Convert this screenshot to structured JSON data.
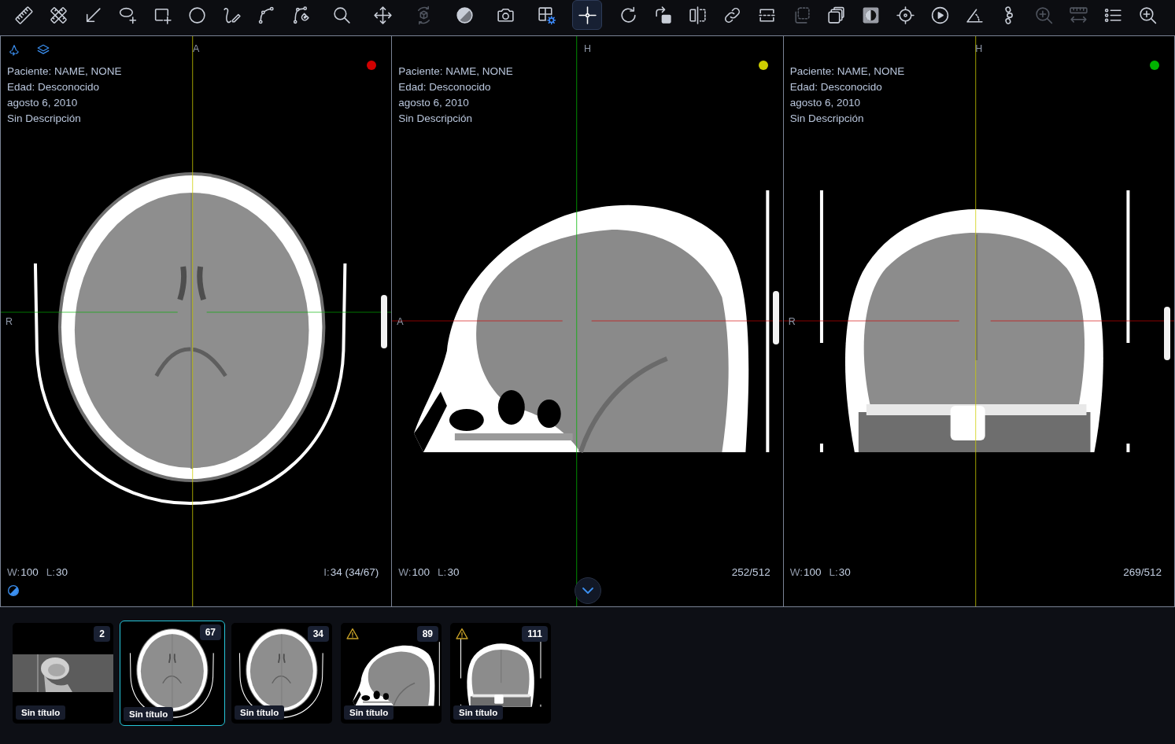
{
  "toolbar": {
    "items": [
      {
        "selected": false,
        "disabled": false
      },
      {
        "selected": false,
        "disabled": false
      },
      {
        "selected": false,
        "disabled": false
      },
      {
        "selected": false,
        "disabled": false
      },
      {
        "selected": false,
        "disabled": false
      },
      {
        "selected": false,
        "disabled": false
      },
      {
        "selected": false,
        "disabled": false
      },
      {
        "selected": false,
        "disabled": false
      },
      {
        "selected": false,
        "disabled": false
      },
      {
        "selected": false,
        "disabled": false
      },
      {
        "selected": false,
        "disabled": false
      },
      {
        "selected": false,
        "disabled": true
      },
      {
        "selected": false,
        "disabled": false
      },
      {
        "selected": false,
        "disabled": false
      },
      {
        "selected": false,
        "disabled": false
      },
      {
        "selected": true,
        "disabled": false
      },
      {
        "selected": false,
        "disabled": false
      },
      {
        "selected": false,
        "disabled": false
      },
      {
        "selected": false,
        "disabled": false
      },
      {
        "selected": false,
        "disabled": false
      },
      {
        "selected": false,
        "disabled": false
      },
      {
        "selected": false,
        "disabled": true
      },
      {
        "selected": false,
        "disabled": false
      },
      {
        "selected": false,
        "disabled": false
      },
      {
        "selected": false,
        "disabled": false
      },
      {
        "selected": false,
        "disabled": false
      },
      {
        "selected": false,
        "disabled": false
      },
      {
        "selected": false,
        "disabled": false
      },
      {
        "selected": false,
        "disabled": true
      },
      {
        "selected": false,
        "disabled": true
      },
      {
        "selected": false,
        "disabled": false
      },
      {
        "selected": false,
        "disabled": false
      }
    ]
  },
  "viewports": [
    {
      "kind": "axial",
      "selected": true,
      "color": "#d00000",
      "orientation_top": "A",
      "orientation_left": "R",
      "patient": "Paciente: NAME, NONE",
      "age": "Edad: Desconocido",
      "date": "agosto 6, 2010",
      "description": "Sin Descripción",
      "window_width": {
        "label": "W:",
        "value": "100"
      },
      "window_level": {
        "label": "L:",
        "value": "30"
      },
      "slice": {
        "label": "I:",
        "value": "34 (34/67)"
      }
    },
    {
      "kind": "sagittal",
      "selected": false,
      "color": "#cccc00",
      "orientation_top": "H",
      "orientation_left": "A",
      "patient": "Paciente: NAME, NONE",
      "age": "Edad: Desconocido",
      "date": "agosto 6, 2010",
      "description": "Sin Descripción",
      "window_width": {
        "label": "W:",
        "value": "100"
      },
      "window_level": {
        "label": "L:",
        "value": "30"
      },
      "slice": {
        "value": "252/512"
      }
    },
    {
      "kind": "coronal",
      "selected": false,
      "color": "#00b300",
      "orientation_top": "H",
      "orientation_left": "R",
      "patient": "Paciente: NAME, NONE",
      "age": "Edad: Desconocido",
      "date": "agosto 6, 2010",
      "description": "Sin Descripción",
      "window_width": {
        "label": "W:",
        "value": "100"
      },
      "window_level": {
        "label": "L:",
        "value": "30"
      },
      "slice": {
        "value": "269/512"
      }
    }
  ],
  "thumbnails": [
    {
      "kind": "scout",
      "count": "2",
      "title": "Sin título",
      "warning": false,
      "selected": false
    },
    {
      "kind": "axial",
      "count": "67",
      "title": "Sin título",
      "warning": false,
      "selected": true
    },
    {
      "kind": "axial",
      "count": "34",
      "title": "Sin título",
      "warning": false,
      "selected": false
    },
    {
      "kind": "sagittal",
      "count": "89",
      "title": "Sin título",
      "warning": true,
      "selected": false
    },
    {
      "kind": "coronal",
      "count": "111",
      "title": "Sin título",
      "warning": true,
      "selected": false
    }
  ]
}
